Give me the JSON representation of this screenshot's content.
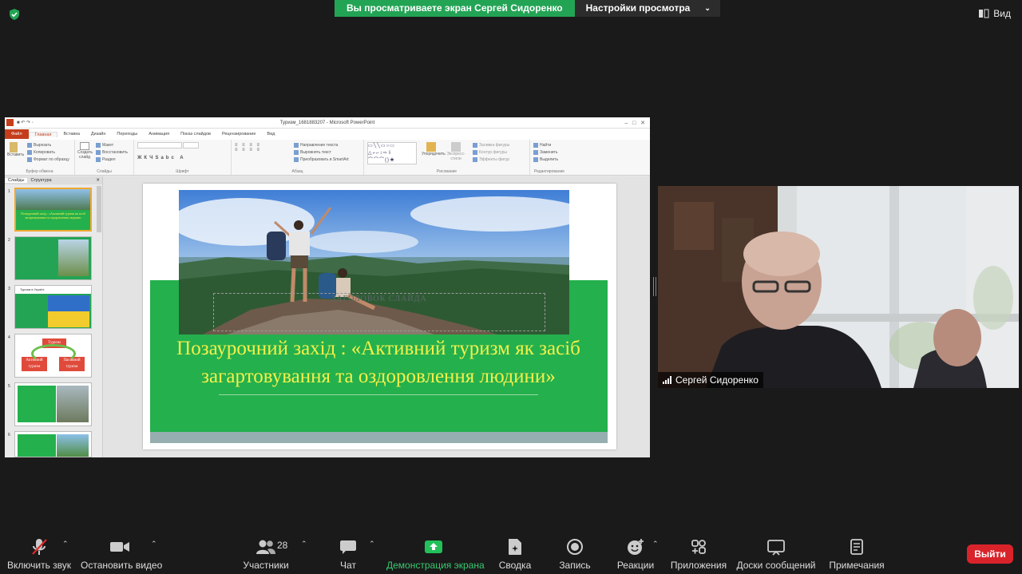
{
  "share_banner": {
    "status": "Вы просматриваете экран Сергей Сидоренко",
    "options": "Настройки просмотра"
  },
  "view_button": "Вид",
  "ppt": {
    "window_title": "Туризм_1681883207  -  Microsoft PowerPoint",
    "tabs": [
      "Файл",
      "Главная",
      "Вставка",
      "Дизайн",
      "Переходы",
      "Анимация",
      "Показ слайдов",
      "Рецензирование",
      "Вид"
    ],
    "clipboard": {
      "paste": "Вставить",
      "cut": "Вырезать",
      "copy": "Копировать",
      "format": "Формат по образцу",
      "label": "Буфер обмена"
    },
    "slides_group": {
      "create": "Создать слайд",
      "layout": "Макет",
      "reset": "Восстановить",
      "section": "Раздел",
      "label": "Слайды"
    },
    "font_label": "Шрифт",
    "paragraph": {
      "direction": "Направление текста",
      "align": "Выровнять текст",
      "smartart": "Преобразовать в SmartArt",
      "label": "Абзац"
    },
    "drawing": {
      "arrange": "Упорядочить",
      "quick_styles": "Экспресс-стили",
      "fill": "Заливка фигуры",
      "outline": "Контур фигуры",
      "effects": "Эффекты фигур",
      "label": "Рисование"
    },
    "editing": {
      "find": "Найти",
      "replace": "Заменить",
      "select": "Выделить",
      "label": "Редактирование"
    },
    "pane_tabs": [
      "Слайды",
      "Структура"
    ],
    "thumb_numbers": [
      "1",
      "2",
      "3",
      "4",
      "5",
      "6"
    ],
    "thumb1_text": "Позаурочний захід : «Активний туризм як засіб загартовування та оздоровлення людини»",
    "thumb3_text": "Туризм в Україні",
    "thumb4": {
      "center": "Туризм",
      "left": "Активний туризм",
      "right": "Пасивний туризм"
    },
    "slide": {
      "placeholder": "ЗАГОЛОВОК СЛАЙДА",
      "title": "Позаурочний захід : «Активний туризм як засіб загартовування та оздоровлення людини»"
    }
  },
  "video": {
    "participant_name": "Сергей Сидоренко"
  },
  "toolbar": {
    "audio": "Включить звук",
    "video": "Остановить видео",
    "participants": "Участники",
    "participants_count": "28",
    "chat": "Чат",
    "share": "Демонстрация экрана",
    "summary": "Сводка",
    "record": "Запись",
    "reactions": "Реакции",
    "apps": "Приложения",
    "whiteboards": "Доски сообщений",
    "notes": "Примечания",
    "end": "Выйти"
  },
  "colors": {
    "share_green": "#23a455",
    "slide_green": "#24b04d",
    "slide_title": "#f4f04a",
    "end_red": "#d9232b"
  }
}
